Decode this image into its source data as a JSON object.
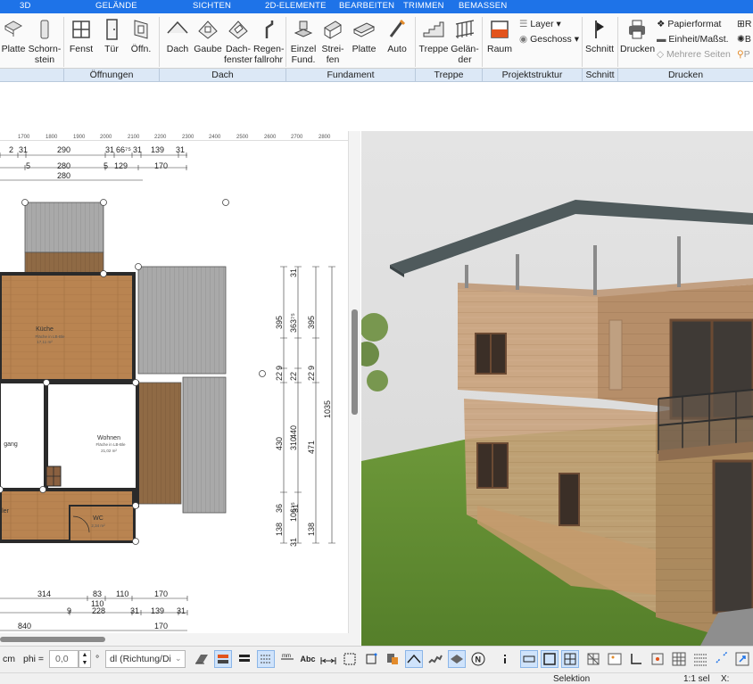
{
  "menu_tabs": [
    "3D",
    "GELÄNDE",
    "SICHTEN",
    "2D-ELEMENTE",
    "BEARBEITEN",
    "TRIMMEN",
    "BEMASSEN"
  ],
  "ribbon": {
    "buttons": [
      {
        "label": "Platte",
        "icon": "slab-icon"
      },
      {
        "label": "Schorn-\nstein",
        "icon": "chimney-icon"
      },
      {
        "label": "Fenst",
        "icon": "window-icon"
      },
      {
        "label": "Tür",
        "icon": "door-icon"
      },
      {
        "label": "Öffn.",
        "icon": "opening-icon"
      },
      {
        "label": "Dach",
        "icon": "roof-icon"
      },
      {
        "label": "Gaube",
        "icon": "dormer-icon"
      },
      {
        "label": "Dach-\nfenster",
        "icon": "roof-window-icon"
      },
      {
        "label": "Regen-\nfallrohr",
        "icon": "downpipe-icon"
      },
      {
        "label": "Einzel\nFund.",
        "icon": "single-foundation-icon"
      },
      {
        "label": "Strei-\nfen",
        "icon": "strip-foundation-icon"
      },
      {
        "label": "Platte",
        "icon": "foundation-slab-icon"
      },
      {
        "label": "Auto",
        "icon": "auto-foundation-icon"
      },
      {
        "label": "Treppe",
        "icon": "stairs-icon"
      },
      {
        "label": "Gelän-\nder",
        "icon": "railing-icon"
      },
      {
        "label": "Raum",
        "icon": "room-icon"
      },
      {
        "label": "Schnitt",
        "icon": "section-icon"
      },
      {
        "label": "Drucken",
        "icon": "printer-icon"
      }
    ],
    "layer_label": "Layer",
    "geschoss_label": "Geschoss",
    "papierformat_label": "Papierformat",
    "einheit_label": "Einheit/Maßst.",
    "mehrere_seiten_label": "Mehrere Seiten",
    "right_cut_1": "R",
    "right_cut_2": "B",
    "right_cut_3": "P"
  },
  "groups": [
    "Öffnungen",
    "Dach",
    "Fundament",
    "Treppe",
    "Projektstruktur",
    "Schnitt",
    "Drucken"
  ],
  "plan": {
    "ruler_ticks": [
      "1700",
      "1800",
      "1900",
      "2000",
      "2100",
      "2200",
      "2300",
      "2400",
      "2500",
      "2600",
      "2700",
      "2800"
    ],
    "top_dims_row1": [
      "2",
      "31",
      "290",
      "31",
      "66⁷⁵",
      "31",
      "139",
      "31"
    ],
    "top_dims_row2": [
      "5",
      "280",
      "5",
      "129",
      "170"
    ],
    "top_dims_row3": [
      "280"
    ],
    "bottom_dims_row1": [
      "314",
      "83",
      "110",
      "170"
    ],
    "bottom_dims_row1b": [
      "110"
    ],
    "bottom_dims_row2": [
      "9",
      "228",
      "31",
      "139",
      "31"
    ],
    "bottom_dims_row3": [
      "840",
      "170"
    ],
    "right_dims_col1": [
      "395",
      "9",
      "22",
      "430",
      "36",
      "138"
    ],
    "right_dims_col2": [
      "31",
      "363⁷⁵",
      "22",
      "310",
      "106⁷⁵",
      "31"
    ],
    "right_dims_col3": [
      "395",
      "9",
      "22",
      "440",
      "31"
    ],
    "right_dims_col4": [
      "471",
      "138"
    ],
    "right_dims_col5": [
      "1035"
    ],
    "rooms": [
      {
        "name": "Küche",
        "sub": "Fläche in LB-Ble",
        "area": "17,11 m²"
      },
      {
        "name": "Wohnen",
        "sub": "Fläche in LB-Ble",
        "area": "21,02 m²"
      },
      {
        "name": "gang",
        "sub": "",
        "area": ""
      },
      {
        "name": "WC",
        "sub": "",
        "area": "2,34 m²"
      },
      {
        "name": "ler",
        "sub": "",
        "area": ""
      }
    ]
  },
  "toolbar": {
    "unit": "cm",
    "phi_label": "phi =",
    "phi_value": "0,0",
    "degree": "°",
    "dl_value": "dl (Richtung/Di",
    "abc_label": "Abc"
  },
  "status": {
    "mode": "Selektion",
    "scale": "1:1 sel",
    "x_label": "X:"
  },
  "colors": {
    "accent": "#1e73e8",
    "group_bar": "#dce8f6",
    "wood_floor": "#b07c4a",
    "roof": "#4f5a5c",
    "grass": "#6e9b3c"
  }
}
